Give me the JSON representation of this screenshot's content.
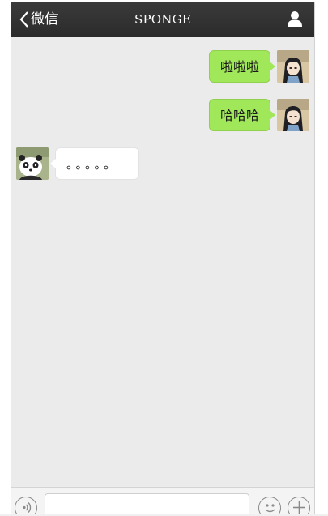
{
  "header": {
    "back_label": "微信",
    "title": "SPONGE",
    "icons": {
      "back": "chevron-left-icon",
      "profile": "user-icon"
    }
  },
  "messages": [
    {
      "direction": "sent",
      "text": "啦啦啦",
      "avatar": "girl-avatar"
    },
    {
      "direction": "sent",
      "text": "哈哈哈",
      "avatar": "girl-avatar"
    },
    {
      "direction": "received",
      "text": "。。。。。",
      "avatar": "panda-avatar"
    }
  ],
  "input_bar": {
    "input_value": "",
    "icons": {
      "voice": "voice-icon",
      "emoji": "emoji-icon",
      "more": "plus-icon"
    }
  },
  "colors": {
    "header_bg": "#2b2b2b",
    "chat_bg": "#ebebeb",
    "sent_bubble": "#a0e75a",
    "received_bubble": "#ffffff"
  }
}
